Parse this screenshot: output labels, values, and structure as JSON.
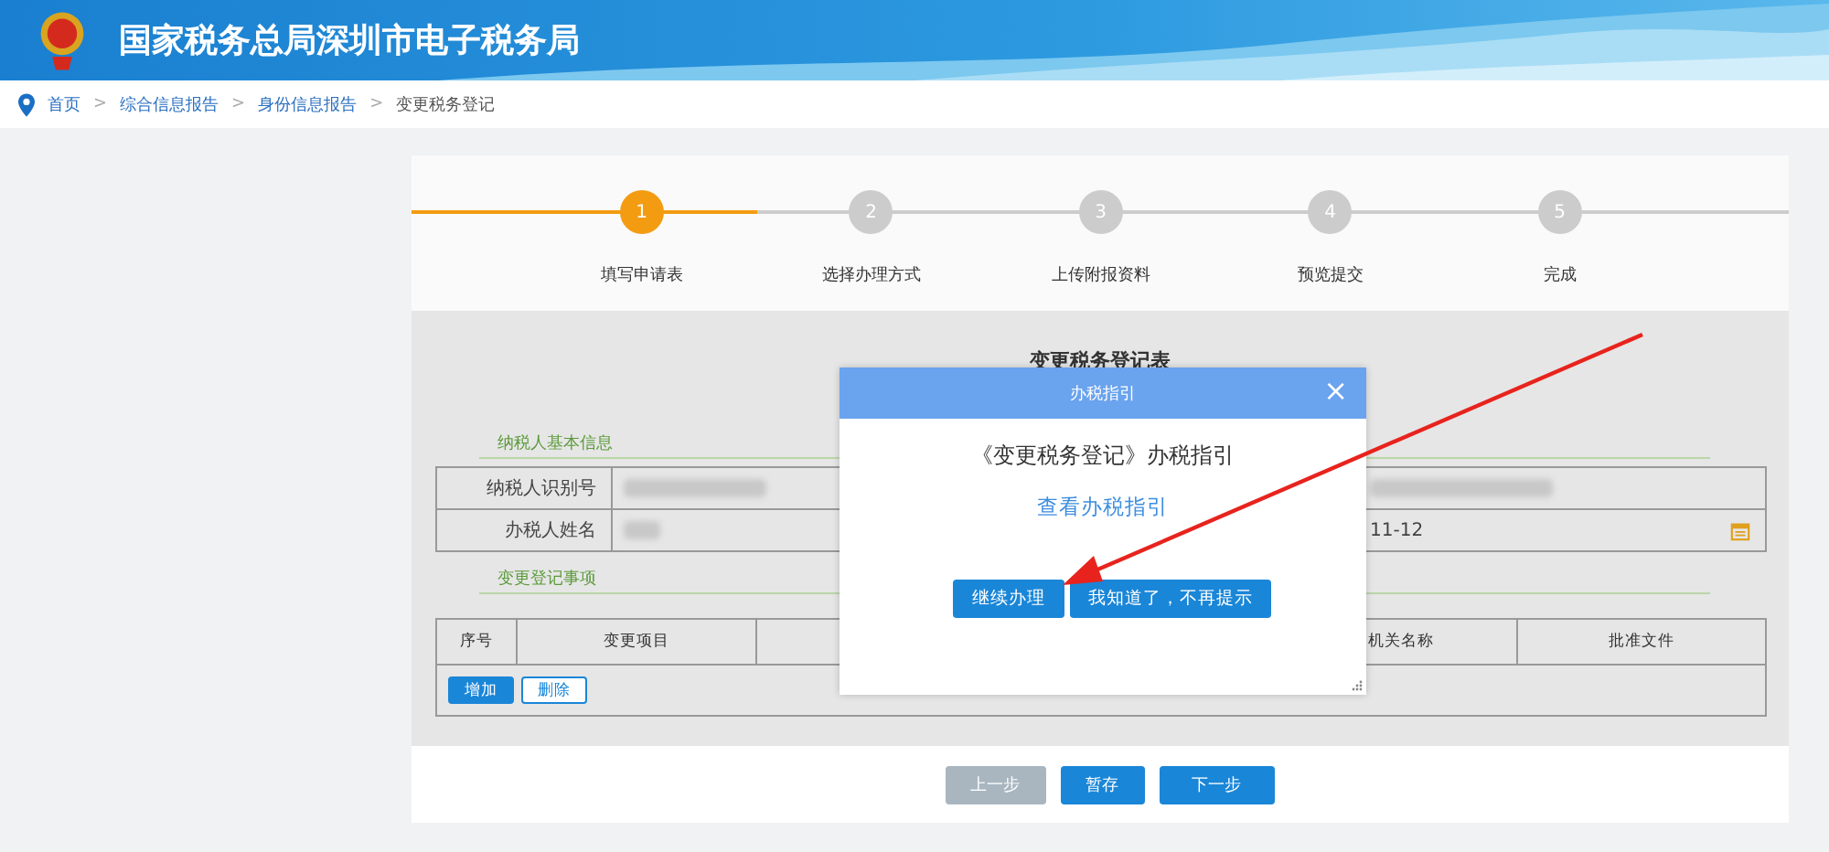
{
  "header": {
    "title": "国家税务总局深圳市电子税务局"
  },
  "breadcrumb": [
    {
      "label": "首页",
      "link": true
    },
    {
      "separator": ">",
      "label": "综合信息报告",
      "link": true
    },
    {
      "separator": ">",
      "label": "身份信息报告",
      "link": true
    },
    {
      "separator": ">",
      "label": "变更税务登记",
      "link": false
    }
  ],
  "steps": [
    {
      "number": "1",
      "label": "填写申请表",
      "selected": true
    },
    {
      "number": "2",
      "label": "选择办理方式",
      "selected": false
    },
    {
      "number": "3",
      "label": "上传附报资料",
      "selected": false
    },
    {
      "number": "4",
      "label": "预览提交",
      "selected": false
    },
    {
      "number": "5",
      "label": "完成",
      "selected": false
    }
  ],
  "form": {
    "title": "变更税务登记表",
    "basic_section": "纳税人基本信息",
    "rows": [
      {
        "label": "纳税人识别号",
        "value_redacted": true,
        "right_value_redacted": true
      },
      {
        "label": "办税人姓名",
        "value_redacted": true,
        "right_value_redacted": false,
        "right_value": "11-12"
      }
    ],
    "change_section": "变更登记事项",
    "table_columns": [
      {
        "label": "序号"
      },
      {
        "label": "变更项目"
      },
      {},
      {
        "label": "机关名称"
      },
      {
        "label": "批准文件"
      }
    ],
    "row_buttons": [
      {
        "label": "增加",
        "kind": "primary"
      },
      {
        "label": "删除",
        "kind": "outline"
      }
    ]
  },
  "footer_buttons": [
    {
      "label": "上一步",
      "disabled": true
    },
    {
      "label": "暂存",
      "disabled": false
    },
    {
      "label": "下一步",
      "disabled": false
    }
  ],
  "dialog": {
    "title": "办税指引",
    "close": "×",
    "message": "《变更税务登记》办税指引",
    "link": "查看办税指引",
    "buttons": [
      "继续办理",
      "我知道了，不再提示"
    ]
  }
}
